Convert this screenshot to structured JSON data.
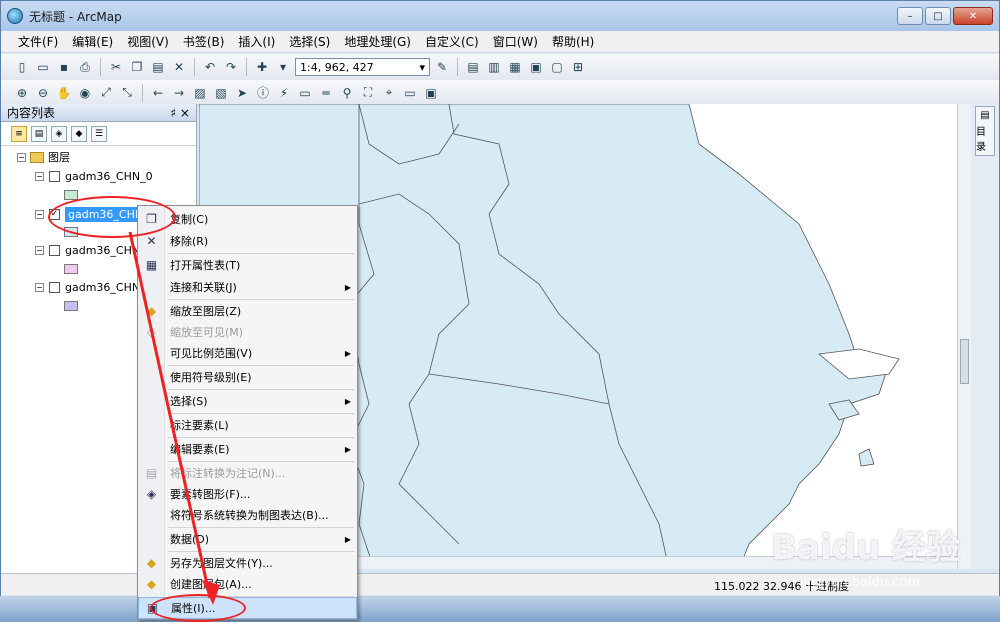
{
  "window": {
    "title": "无标题 - ArcMap",
    "min": "–",
    "max": "□",
    "close": "✕"
  },
  "menu": [
    "文件(F)",
    "编辑(E)",
    "视图(V)",
    "书签(B)",
    "插入(I)",
    "选择(S)",
    "地理处理(G)",
    "自定义(C)",
    "窗口(W)",
    "帮助(H)"
  ],
  "toolbar": {
    "scale": "1:4, 962, 427"
  },
  "toc": {
    "title": "内容列表",
    "pin": "♯ ×",
    "root": "图层",
    "layers": [
      {
        "name": "gadm36_CHN_0",
        "checked": false,
        "color": "#c9ead2"
      },
      {
        "name": "gadm36_CHN",
        "checked": true,
        "color": "#cfe7f4",
        "selected": true
      },
      {
        "name": "gadm36_CHN",
        "checked": false,
        "color": "#f2c9ef"
      },
      {
        "name": "gadm36_CHN",
        "checked": false,
        "color": "#c8bdf0"
      }
    ]
  },
  "catalog_tab": "目录",
  "status": {
    "coords": "115.022  32.946 十进制度"
  },
  "context_menu": [
    {
      "label": "复制(C)",
      "icon": "copy-icon",
      "glyph": "❐"
    },
    {
      "label": "移除(R)",
      "icon": "remove-icon",
      "glyph": "✕"
    },
    {
      "label": "打开属性表(T)",
      "icon": "table-icon",
      "glyph": "▦"
    },
    {
      "label": "连接和关联(J)",
      "submenu": true
    },
    {
      "label": "缩放至图层(Z)",
      "icon": "zoom-layer-icon",
      "glyph": "◆"
    },
    {
      "label": "缩放至可见(M)",
      "disabled": true,
      "icon": "zoom-visible-icon",
      "glyph": "◇"
    },
    {
      "label": "可见比例范围(V)",
      "submenu": true
    },
    {
      "label": "使用符号级别(E)"
    },
    {
      "label": "选择(S)",
      "submenu": true
    },
    {
      "label": "标注要素(L)"
    },
    {
      "label": "编辑要素(E)",
      "submenu": true
    },
    {
      "label": "将标注转换为注记(N)...",
      "disabled": true,
      "icon": "convert-label-icon",
      "glyph": "▤"
    },
    {
      "label": "要素转图形(F)...",
      "icon": "feature-graphic-icon",
      "glyph": "◈"
    },
    {
      "label": "将符号系统转换为制图表达(B)..."
    },
    {
      "label": "数据(D)",
      "submenu": true
    },
    {
      "label": "另存为图层文件(Y)...",
      "icon": "layer-file-icon",
      "glyph": "◆"
    },
    {
      "label": "创建图层包(A)...",
      "icon": "layer-package-icon",
      "glyph": "◆"
    },
    {
      "label": "属性(I)...",
      "icon": "properties-icon",
      "glyph": "▣",
      "highlight": true
    }
  ],
  "watermark": {
    "brand": "Baidu 经验",
    "url": "jingyan.baidu.com"
  }
}
